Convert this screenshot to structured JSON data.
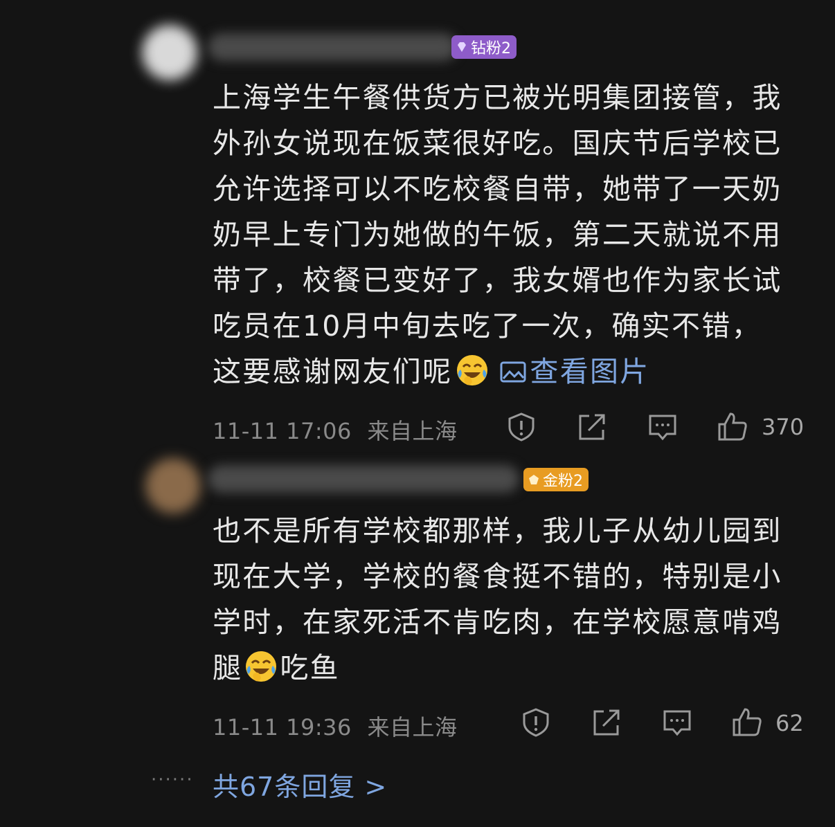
{
  "comments": [
    {
      "badge": "钻粉2",
      "text_lines": [
        "上海学生午餐供货方已被光明集团接管，我",
        "外孙女说现在饭菜很好吃。国庆节后学校已",
        "允许选择可以不吃校餐自带，她带了一天奶",
        "奶早上专门为她做的午饭，第二天就说不用",
        "带了，校餐已变好了，我女婿也作为家长试",
        "吃员在10月中旬去吃了一次，确实不错，"
      ],
      "text_last": "这要感谢网友们呢",
      "emoji": "laughing-crying-emoji",
      "link_label": "查看图片",
      "timestamp": "11-11 17:06",
      "location": "来自上海",
      "likes": "370"
    },
    {
      "badge": "金粉2",
      "text_lines": [
        "也不是所有学校都那样，我儿子从幼儿园到",
        "现在大学，学校的餐食挺不错的，特别是小",
        "学时，在家死活不肯吃肉，在学校愿意啃鸡"
      ],
      "text_last_a": "腿",
      "text_last_b": "吃鱼",
      "emoji": "laughing-crying-emoji",
      "timestamp": "11-11 19:36",
      "location": "来自上海",
      "likes": "62"
    }
  ],
  "replies_label": "共67条回复 >",
  "colors": {
    "background": "#141414",
    "link": "#7fa6e0",
    "badge_diamond": "#9b6bd6",
    "badge_gold": "#f0a62a"
  },
  "icons": [
    "report-icon",
    "share-icon",
    "comment-icon",
    "like-icon"
  ]
}
